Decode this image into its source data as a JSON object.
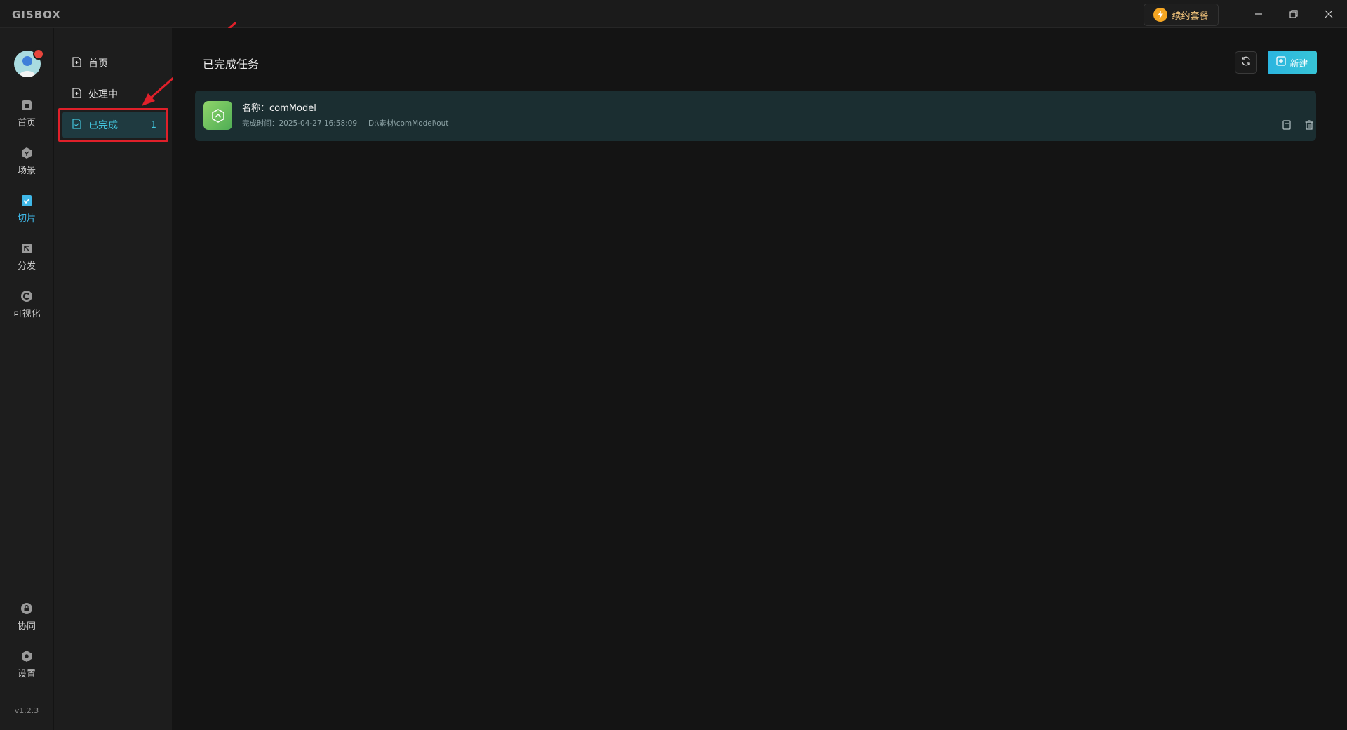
{
  "app": {
    "logo": "GISBOX",
    "renew_label": "续约套餐",
    "version": "v1.2.3"
  },
  "rail": {
    "items": [
      {
        "label": "首页",
        "icon": "home-icon"
      },
      {
        "label": "场景",
        "icon": "cube-icon"
      },
      {
        "label": "切片",
        "icon": "slice-icon"
      },
      {
        "label": "分发",
        "icon": "distribute-icon"
      },
      {
        "label": "可视化",
        "icon": "visualize-icon"
      }
    ],
    "bottom_items": [
      {
        "label": "协同",
        "icon": "lock-icon"
      },
      {
        "label": "设置",
        "icon": "gear-icon"
      }
    ]
  },
  "subnav": {
    "items": [
      {
        "label": "首页"
      },
      {
        "label": "处理中"
      },
      {
        "label": "已完成",
        "count": "1"
      }
    ]
  },
  "main": {
    "title": "已完成任务",
    "new_label": "新建",
    "tasks": [
      {
        "name_label": "名称：",
        "name": "comModel",
        "time_label": "完成时间：",
        "time": "2025-04-27 16:58:09",
        "path": "D:\\素材\\comModel\\out"
      }
    ]
  },
  "colors": {
    "accent": "#3fb8e8",
    "active_bg": "#1f3a40",
    "highlight": "#e0202a",
    "card_bg": "#1b2e31"
  }
}
